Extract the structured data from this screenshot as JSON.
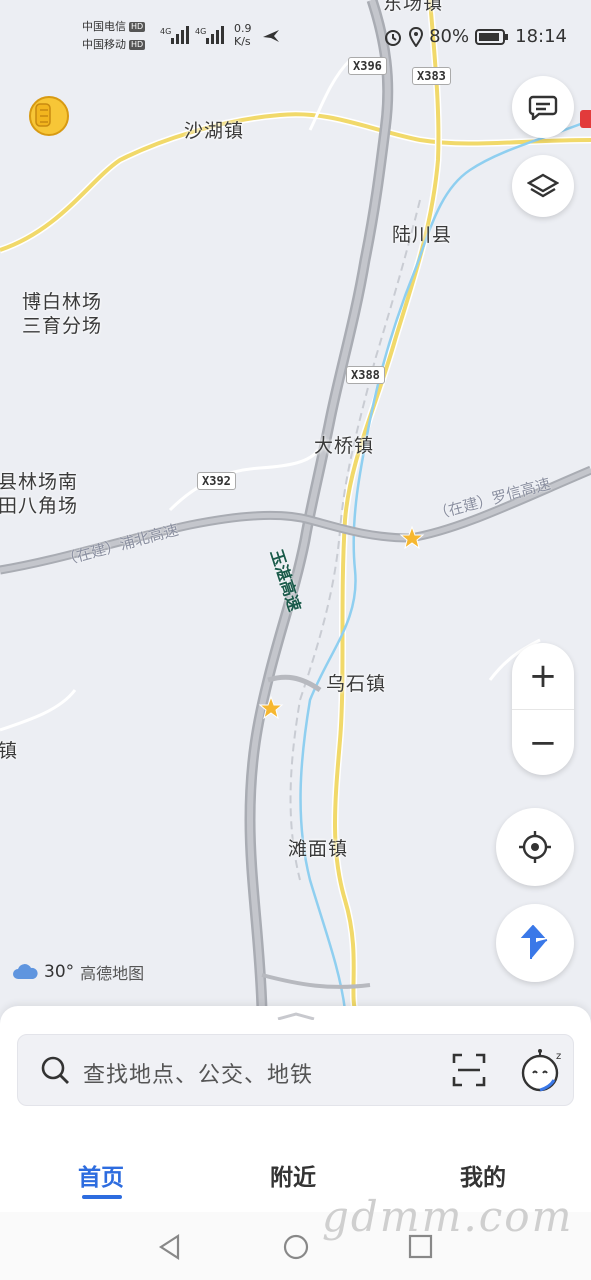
{
  "status_bar": {
    "carrier1": "中国电信",
    "carrier2": "中国移动",
    "hd": "HD",
    "net": "4G",
    "rate_value": "0.9",
    "rate_unit": "K/s",
    "battery": "80%",
    "time": "18:14"
  },
  "map": {
    "places": {
      "top_partial": "东场镇",
      "shahu": "沙湖镇",
      "luchuan": "陆川县",
      "bobai_1": "博白林场",
      "bobai_2": "三育分场",
      "daqiao": "大桥镇",
      "county_1": "县林场南",
      "county_2": "田八角场",
      "wushi": "乌石镇",
      "left_partial": "镇",
      "tanmian": "滩面镇"
    },
    "roads": {
      "x396": "X396",
      "x383": "X383",
      "x388": "X388",
      "x392": "X392"
    },
    "highways": {
      "yuzhan": "玉湛高速",
      "puqing": "（在建）浦北高速",
      "luoxin": "（在建）罗信高速"
    },
    "colors": {
      "background": "#eceef3",
      "expressway": "#b7b9bf",
      "provincial": "#f1d96a",
      "river": "#8fcff0",
      "accent": "#2d6cdf"
    }
  },
  "controls": {
    "zoom_in": "+",
    "zoom_out": "−"
  },
  "weather": {
    "temp": "30°",
    "brand": "高德地图"
  },
  "search": {
    "placeholder": "查找地点、公交、地铁"
  },
  "tabs": [
    {
      "label": "首页",
      "active": true
    },
    {
      "label": "附近",
      "active": false
    },
    {
      "label": "我的",
      "active": false
    }
  ],
  "watermark": "gdmm.com"
}
